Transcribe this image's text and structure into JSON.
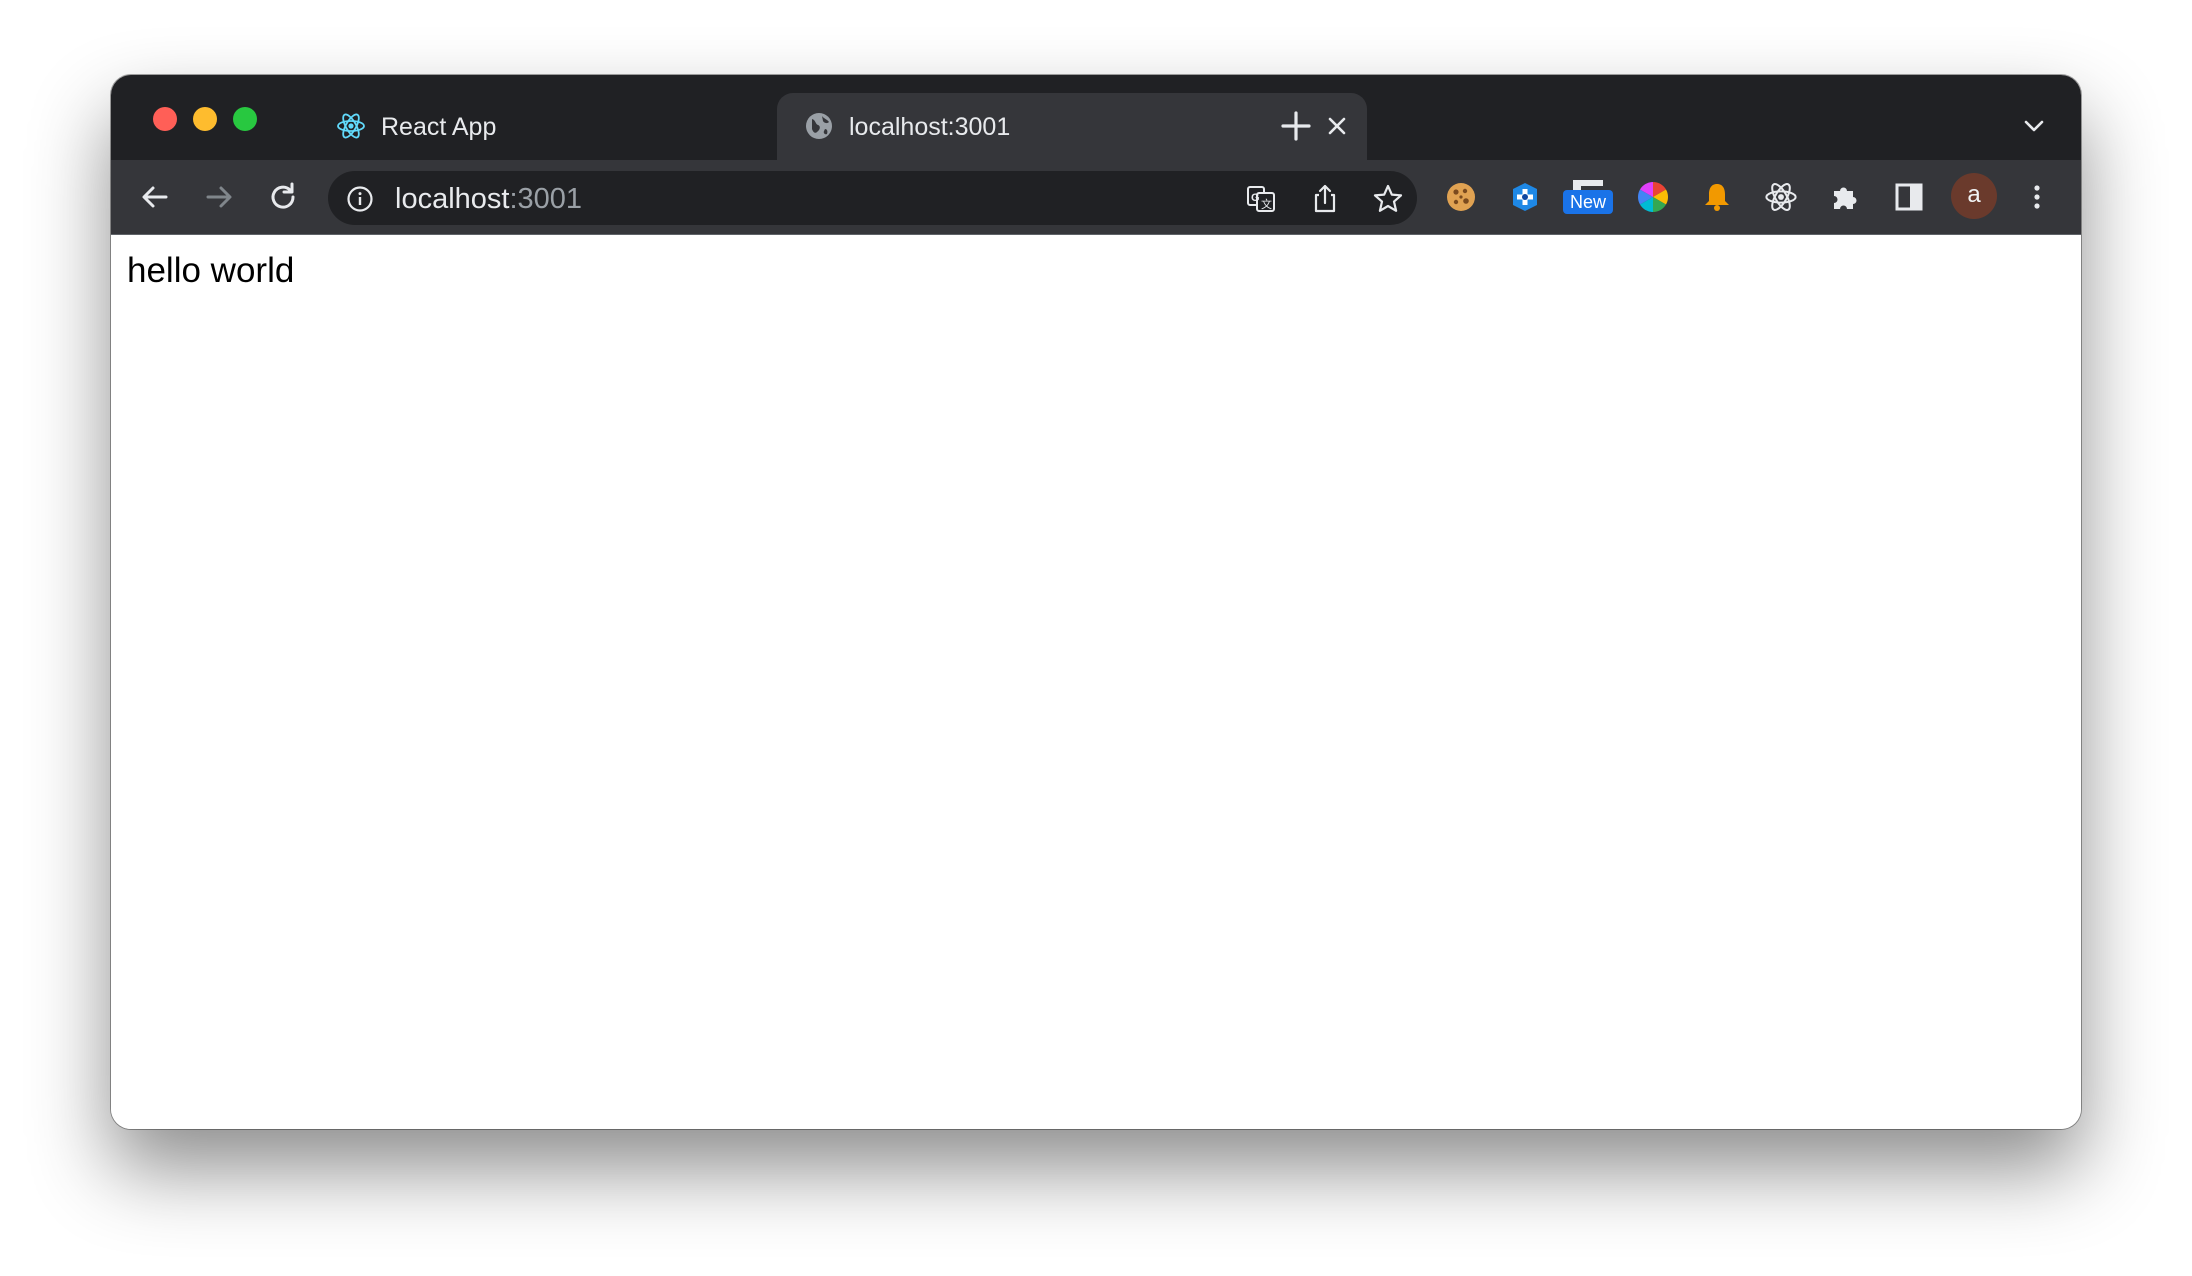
{
  "window": {
    "controls": [
      "close",
      "minimize",
      "maximize"
    ]
  },
  "tabs": [
    {
      "title": "React App",
      "icon": "react-icon",
      "active": false
    },
    {
      "title": "localhost:3001",
      "icon": "globe-icon",
      "active": true
    }
  ],
  "toolbar": {
    "url_host": "localhost",
    "url_port": ":3001",
    "new_badge": "New",
    "avatar_initial": "a",
    "extensions": [
      "cookie-icon",
      "plus-cross-icon",
      "new-extension-icon",
      "color-picker-icon",
      "bell-icon",
      "react-devtools-icon",
      "puzzle-icon",
      "side-panel-icon"
    ]
  },
  "page": {
    "text": "hello world"
  },
  "colors": {
    "tabstrip": "#202124",
    "toolbar": "#35363a",
    "omnibox": "#202124",
    "react_accent": "#61dafb",
    "close": "#ff5f57",
    "minimize": "#febc2e",
    "maximize": "#28c840"
  }
}
